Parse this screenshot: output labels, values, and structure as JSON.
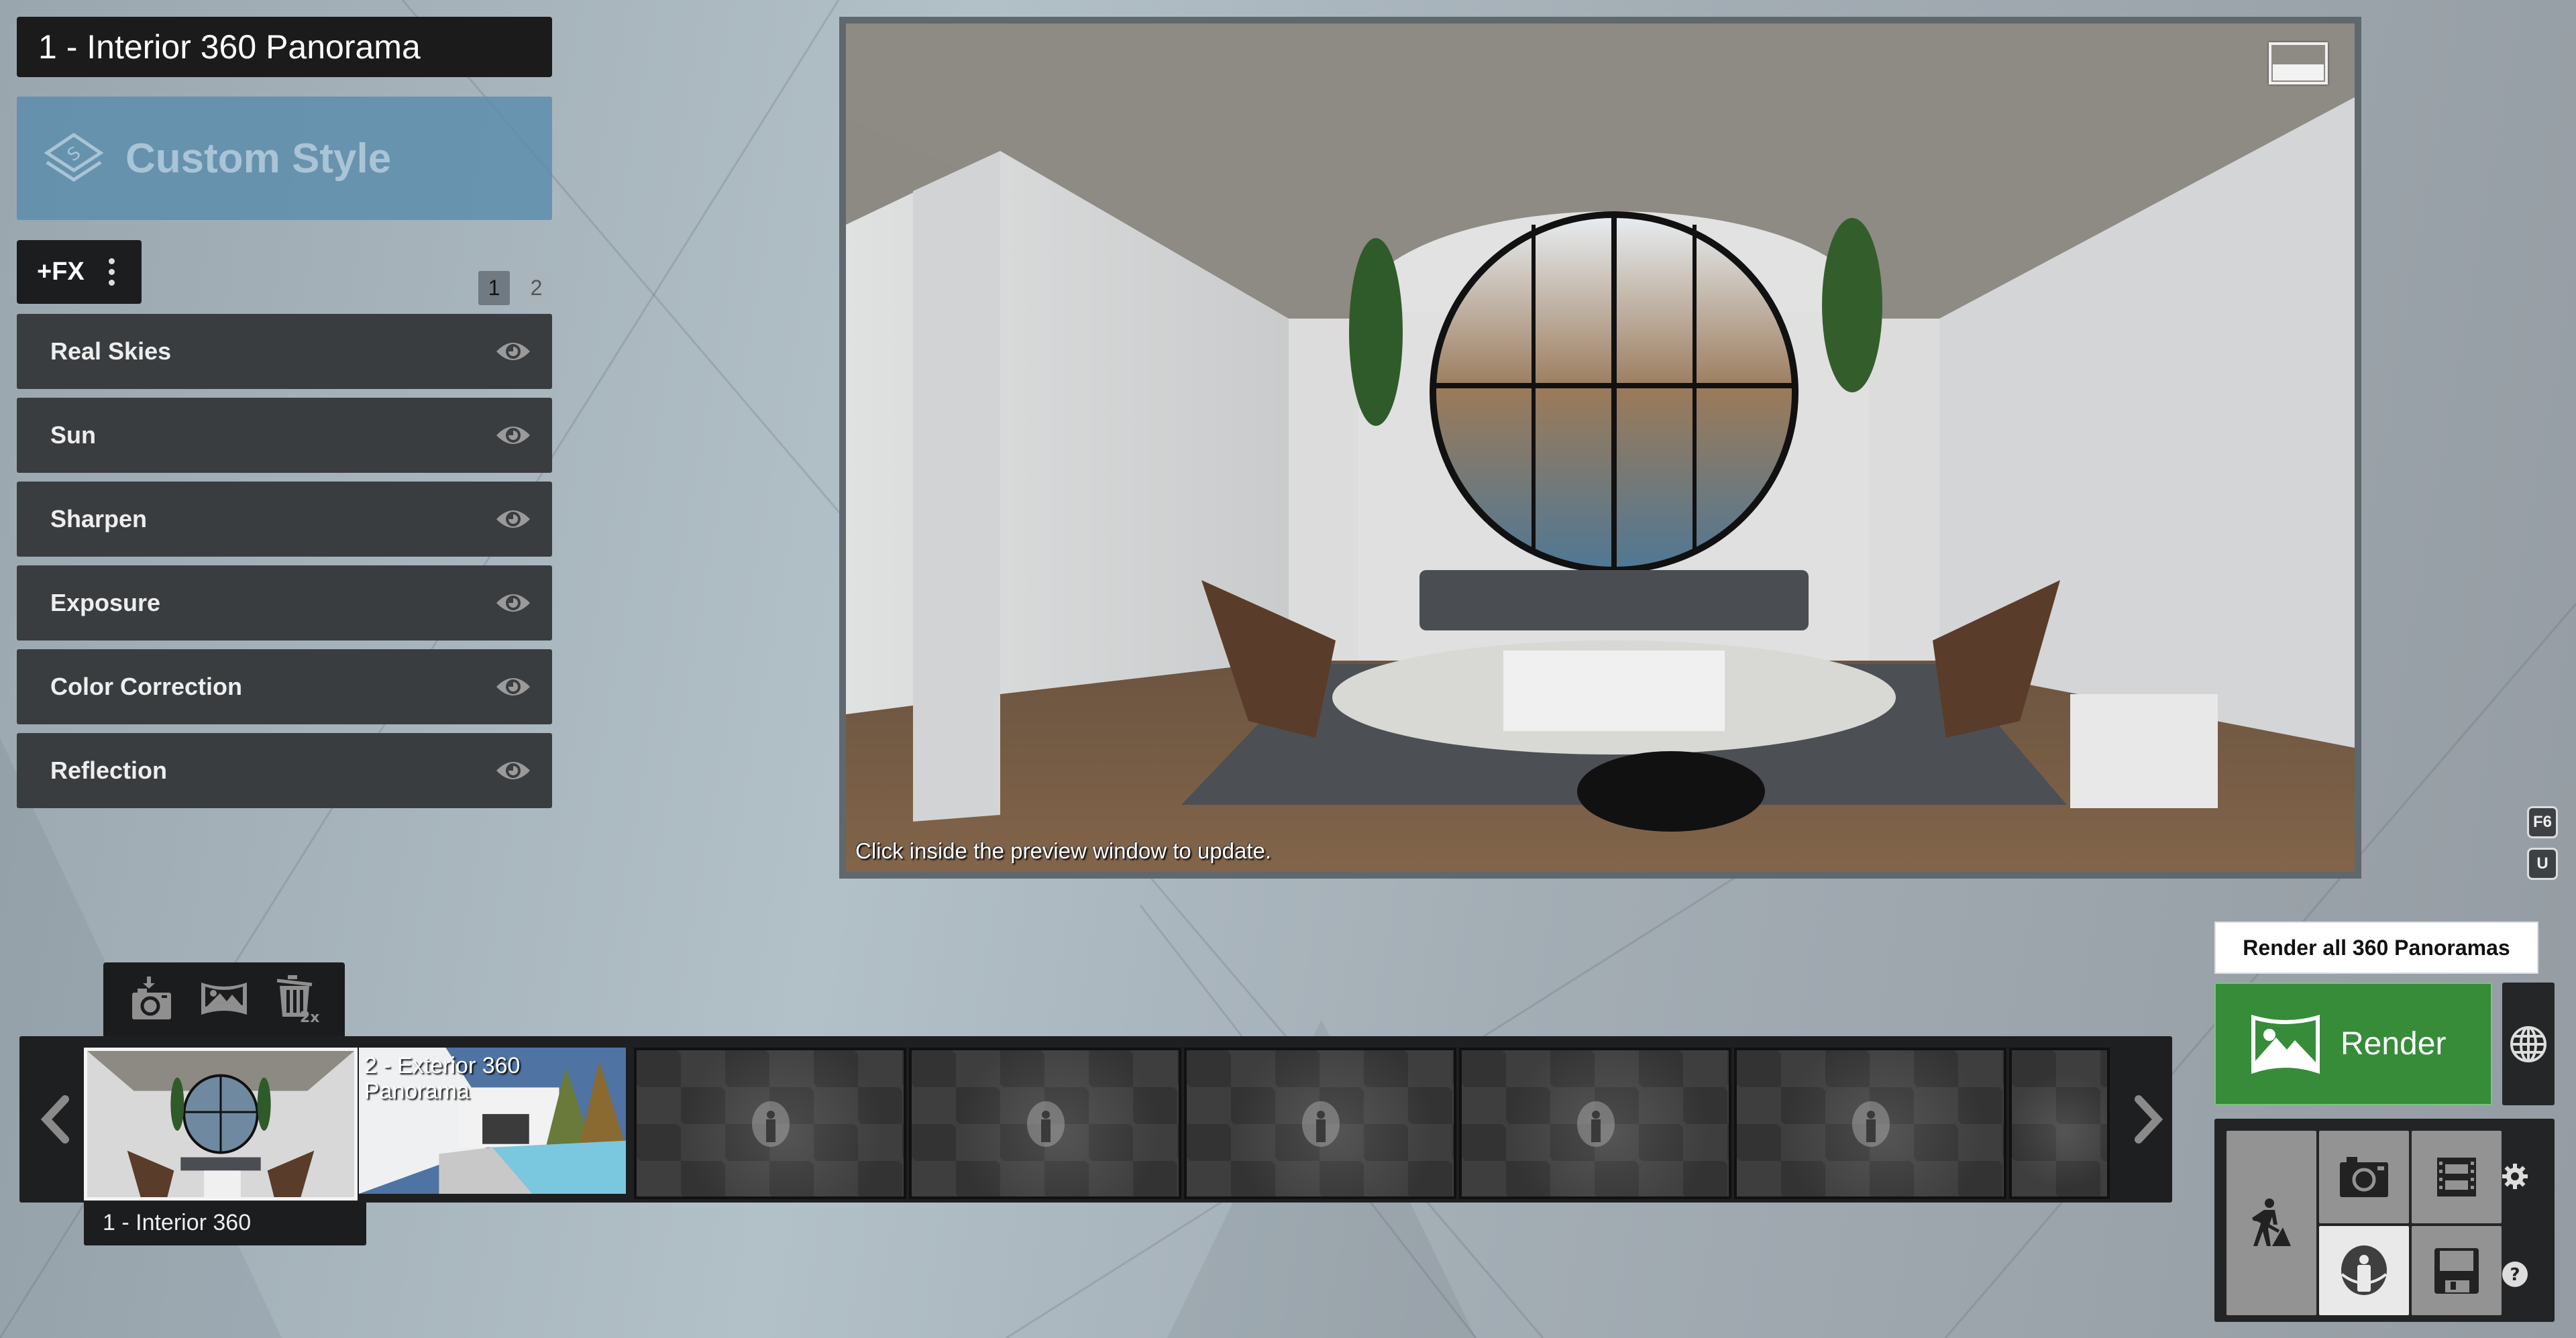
{
  "title": "1 - Interior 360 Panorama",
  "style_button": {
    "label": "Custom Style",
    "icon": "style-layers-icon"
  },
  "fx": {
    "add_label": "+FX",
    "menu_icon": "kebab-menu-icon",
    "pages": [
      "1",
      "2"
    ],
    "active_page": "1",
    "effects": [
      {
        "label": "Real Skies",
        "visible": true
      },
      {
        "label": "Sun",
        "visible": true
      },
      {
        "label": "Sharpen",
        "visible": true
      },
      {
        "label": "Exposure",
        "visible": true
      },
      {
        "label": "Color Correction",
        "visible": true
      },
      {
        "label": "Reflection",
        "visible": true
      }
    ]
  },
  "preview": {
    "hint": "Click inside the preview window to update.",
    "layout_toggle_icon": "layout-toggle-icon"
  },
  "shortcuts": {
    "f6": "F6",
    "u": "U"
  },
  "thumb_toolbar": {
    "icons": [
      "add-camera-icon",
      "panorama-icon",
      "delete-2x-icon"
    ],
    "delete_badge": "2x"
  },
  "filmstrip": {
    "tiles": [
      {
        "caption": "",
        "type": "interior",
        "selected": true
      },
      {
        "caption": "2 - Exterior 360 Panorama",
        "type": "exterior",
        "selected": false
      },
      {
        "caption": "",
        "type": "empty"
      },
      {
        "caption": "",
        "type": "empty"
      },
      {
        "caption": "",
        "type": "empty"
      },
      {
        "caption": "",
        "type": "empty"
      },
      {
        "caption": "",
        "type": "empty"
      },
      {
        "caption": "",
        "type": "empty"
      }
    ],
    "selected_label": "1 - Interior 360"
  },
  "render": {
    "render_all_label": "Render all 360 Panoramas",
    "render_label": "Render",
    "accent": "#378c39"
  },
  "modes": {
    "build": "build-mode-icon",
    "photo": "photo-mode-icon",
    "video": "video-mode-icon",
    "panorama": "panorama-360-mode-icon",
    "save": "save-icon",
    "settings": "gear-icon",
    "help": "help-icon",
    "active": "panorama"
  }
}
